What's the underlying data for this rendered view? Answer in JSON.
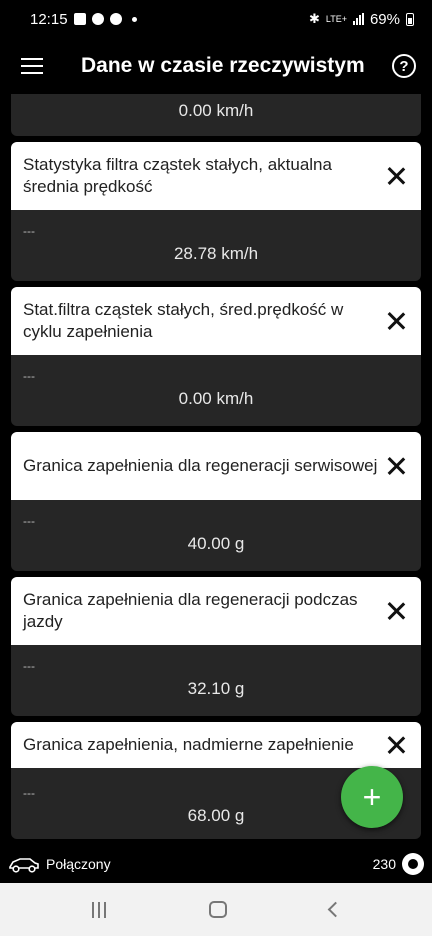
{
  "status_bar": {
    "time": "12:15",
    "network": "LTE+",
    "battery": "69%"
  },
  "app_bar": {
    "title": "Dane w czasie rzeczywistym",
    "help_label": "?"
  },
  "cards": [
    {
      "title": "",
      "subtitle": "",
      "value": "0.00 km/h"
    },
    {
      "title": "Statystyka filtra cząstek stałych, aktualna średnia prędkość",
      "subtitle": "---",
      "value": "28.78 km/h"
    },
    {
      "title": "Stat.filtra cząstek stałych, śred.prędkość w cyklu zapełnienia",
      "subtitle": "---",
      "value": "0.00 km/h"
    },
    {
      "title": "Granica zapełnienia dla regeneracji serwisowej",
      "subtitle": "---",
      "value": "40.00 g"
    },
    {
      "title": "Granica zapełnienia dla regeneracji podczas jazdy",
      "subtitle": "---",
      "value": "32.10 g"
    },
    {
      "title": "Granica zapełnienia, nadmierne zapełnienie",
      "subtitle": "---",
      "value": "68.00 g"
    }
  ],
  "fab": {
    "label": "+"
  },
  "info_bar": {
    "connection_status": "Połączony",
    "count": "230"
  },
  "colors": {
    "accent": "#44b549",
    "card_bg": "#262626",
    "background": "#000000"
  }
}
